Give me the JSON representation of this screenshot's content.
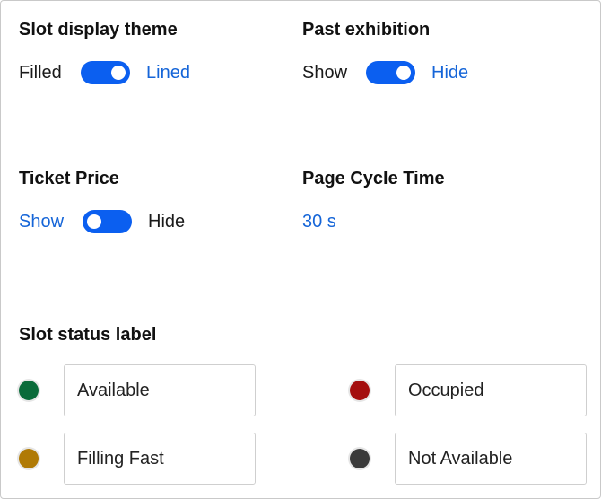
{
  "slot_display_theme": {
    "title": "Slot display theme",
    "left_label": "Filled",
    "right_label": "Lined",
    "state": "on"
  },
  "past_exhibition": {
    "title": "Past exhibition",
    "left_label": "Show",
    "right_label": "Hide",
    "state": "on"
  },
  "ticket_price": {
    "title": "Ticket Price",
    "left_label": "Show",
    "right_label": "Hide",
    "state": "off"
  },
  "page_cycle_time": {
    "title": "Page Cycle Time",
    "value": "30 s"
  },
  "slot_status_label": {
    "title": "Slot status label",
    "items": [
      {
        "value": "Available",
        "color": "#0a6b3a"
      },
      {
        "value": "Occupied",
        "color": "#a40e0e"
      },
      {
        "value": "Filling Fast",
        "color": "#b07a05"
      },
      {
        "value": "Not Available",
        "color": "#3a3a3a"
      }
    ]
  },
  "colors": {
    "accent": "#0b5ff0",
    "link": "#1565d8"
  }
}
